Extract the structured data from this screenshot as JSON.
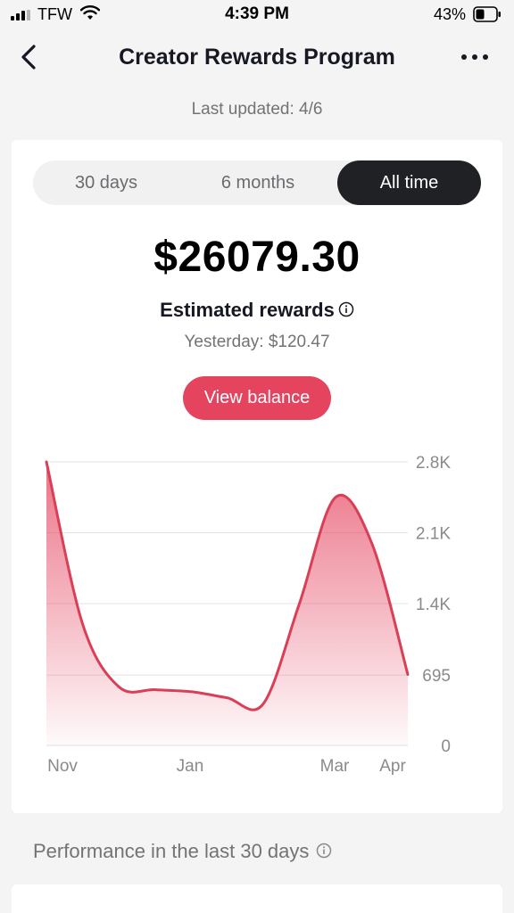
{
  "status_bar": {
    "carrier": "TFW",
    "time": "4:39 PM",
    "battery_percent": "43%",
    "battery_level": 0.43,
    "signal_bars": 3,
    "icons": [
      "signal-icon",
      "wifi-icon",
      "battery-icon"
    ]
  },
  "nav": {
    "title": "Creator Rewards Program",
    "icons": [
      "back-chevron-icon",
      "more-dots-icon"
    ]
  },
  "last_updated": "Last updated: 4/6",
  "period_tabs": [
    {
      "label": "30 days",
      "active": false
    },
    {
      "label": "6 months",
      "active": false
    },
    {
      "label": "All time",
      "active": true
    }
  ],
  "rewards": {
    "amount": "$26079.30",
    "label": "Estimated rewards",
    "yesterday": "Yesterday: $120.47",
    "button_label": "View balance"
  },
  "colors": {
    "accent": "#e5445f",
    "line": "#d93f57",
    "dark_tab": "#202124"
  },
  "chart_data": {
    "type": "area",
    "x_tick_labels": [
      "Nov",
      "Jan",
      "Mar",
      "Apr"
    ],
    "y_tick_labels": [
      "2.8K",
      "2.1K",
      "1.4K",
      "695",
      "0"
    ],
    "y_ticks": [
      2800,
      2100,
      1400,
      695,
      0
    ],
    "ylim": [
      0,
      2800
    ],
    "grid": true,
    "series": [
      {
        "x": [
          "Nov 1",
          "Nov 15",
          "Dec 1",
          "Dec 15",
          "Jan 1",
          "Jan 15",
          "Feb 1",
          "Feb 15",
          "Mar 1",
          "Mar 15",
          "Apr 1"
        ],
        "values": [
          2800,
          1200,
          580,
          550,
          530,
          470,
          410,
          1400,
          2450,
          2000,
          700
        ]
      }
    ]
  },
  "performance_heading": "Performance in the last 30 days"
}
